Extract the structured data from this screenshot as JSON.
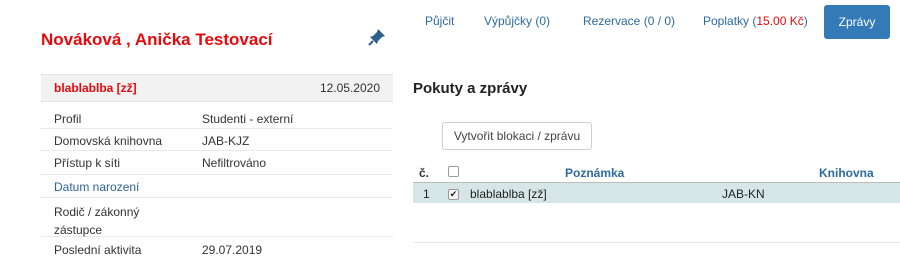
{
  "patron": {
    "name": "Nováková , Anička Testovací"
  },
  "icons": {
    "pin": "pin-icon",
    "check": "checkbox-icon"
  },
  "message": {
    "title": "blablablba [zž]",
    "date": "12.05.2020"
  },
  "info": [
    {
      "label": "Profil",
      "value": "Studenti - externí"
    },
    {
      "label": "Domovská knihovna",
      "value": "JAB-KJZ"
    },
    {
      "label": "Přístup k síti",
      "value": "Nefiltrováno"
    },
    {
      "label": "Datum narození",
      "value": ""
    },
    {
      "label": "Rodič / zákonný zástupce",
      "value": ""
    },
    {
      "label": "Poslední aktivita",
      "value": "29.07.2019"
    }
  ],
  "tabs": {
    "borrow": "Půjčit",
    "loans": "Výpůjčky (0)",
    "reservations": "Rezervace (0 / 0)",
    "fees_label": "Poplatky (",
    "fees_amount": "15.00 Kč",
    "fees_close": ")",
    "messages": "Zprávy"
  },
  "section_title": "Pokuty a zprávy",
  "create_button": "Vytvořit blokaci / zprávu",
  "table": {
    "headers": {
      "num": "č.",
      "note": "Poznámka",
      "library": "Knihovna"
    },
    "rows": [
      {
        "num": "1",
        "note": "blablablba [zž]",
        "library": "JAB-KN",
        "checked": true
      }
    ]
  },
  "colors": {
    "accent": "#337ab7",
    "alert": "#e8090c",
    "row_highlight": "#d6e6e7"
  }
}
